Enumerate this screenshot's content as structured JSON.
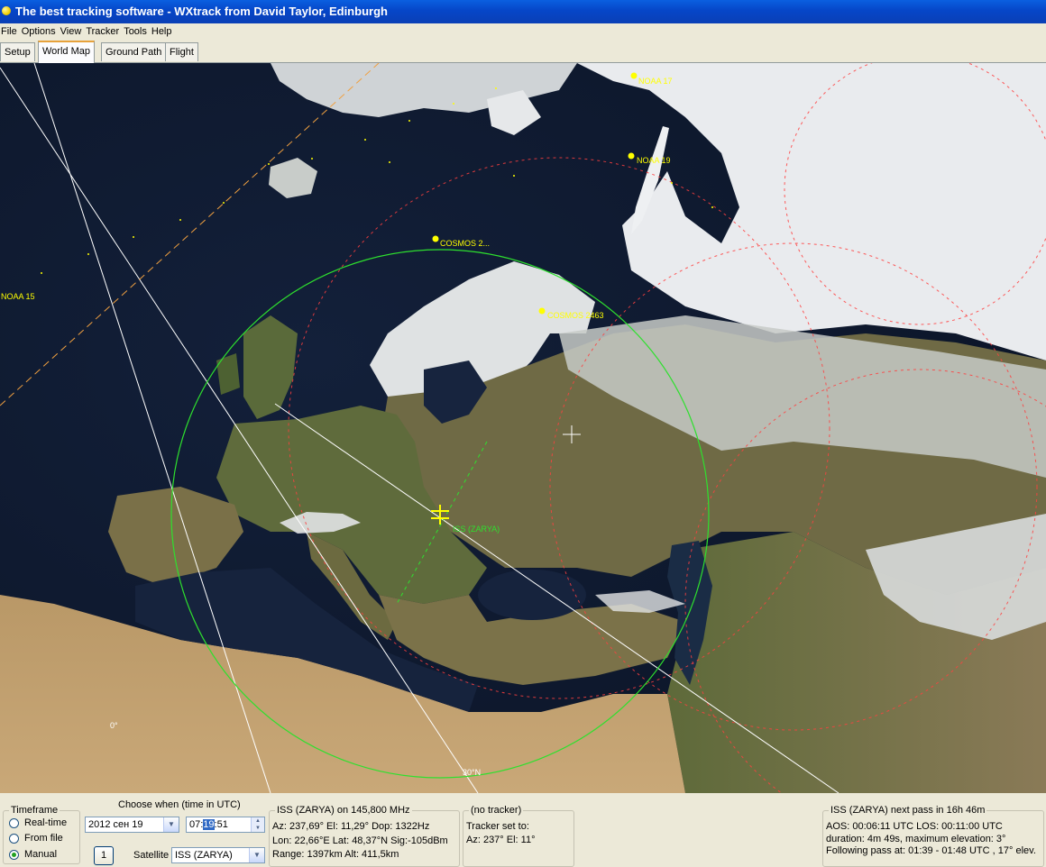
{
  "window": {
    "title": "The best tracking software - WXtrack from David Taylor, Edinburgh"
  },
  "menu": [
    "File",
    "Options",
    "View",
    "Tracker",
    "Tools",
    "Help"
  ],
  "tabs": [
    "Setup",
    "World Map",
    "Ground Path",
    "Flight"
  ],
  "active_tab": "World Map",
  "map": {
    "satellites": {
      "noaa17": "NOAA 17",
      "noaa19": "NOAA 19",
      "noaa15": "NOAA 15",
      "cosmos1": "COSMOS 2...",
      "cosmos2": "COSMOS 2463",
      "iss": "ISS (ZARYA)"
    },
    "grid_labels": {
      "lon0": "0°",
      "lat30": "30°N"
    },
    "colors": {
      "iss_track": "#2ee02e",
      "sat_marker": "#ffff00",
      "range_ring": "#ff4040"
    }
  },
  "timeframe": {
    "legend": "Timeframe",
    "options": [
      "Real-time",
      "From file",
      "Manual"
    ],
    "selected": "Manual"
  },
  "choose_when": {
    "label": "Choose when (time in UTC)",
    "date": "2012 сен 19",
    "time_h": "07:",
    "time_m": "19",
    "time_s": ":51",
    "step_button": "1",
    "satellite_label": "Satellite",
    "satellite_value": "ISS (ZARYA)"
  },
  "sat_info": {
    "legend": "ISS (ZARYA) on 145,800 MHz",
    "line1": "Az: 237,69°  El: 11,29°  Dop: 1322Hz",
    "line2": "Lon: 22,66°E  Lat: 48,37°N  Sig:-105dBm",
    "line3": "Range: 1397km  Alt: 411,5km"
  },
  "tracker": {
    "legend": "(no tracker)",
    "line1": "Tracker set to:",
    "line2": "Az: 237°  El: 11°"
  },
  "next_pass": {
    "legend": "ISS (ZARYA) next pass in 16h 46m",
    "line1": "AOS: 00:06:11 UTC  LOS: 00:11:00 UTC",
    "line2": "duration: 4m 49s,  maximum elevation: 3°",
    "line3": "Following pass at: 01:39 - 01:48 UTC , 17° elev."
  }
}
